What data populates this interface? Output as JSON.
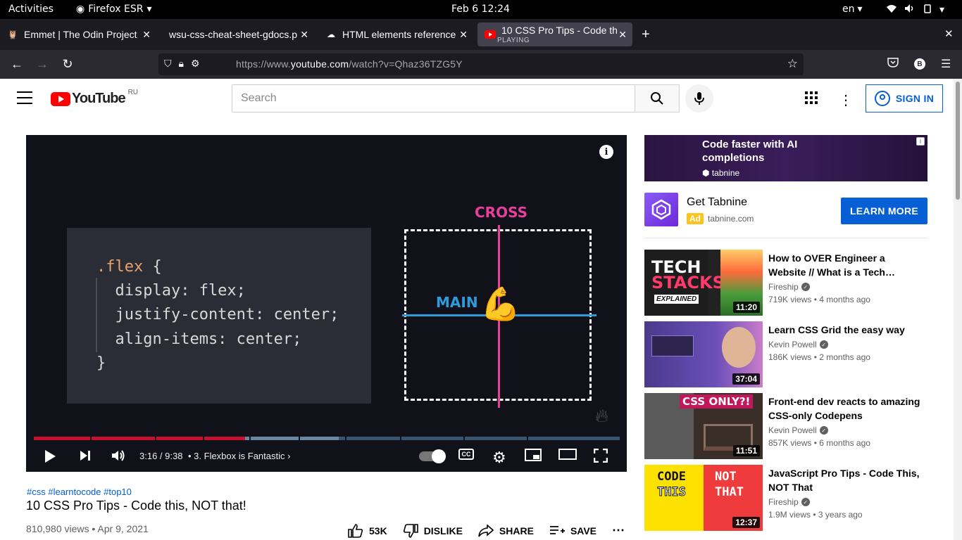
{
  "gnome": {
    "activities": "Activities",
    "app": "Firefox ESR",
    "clock": "Feb 6  12:24",
    "lang": "en"
  },
  "tabs": [
    {
      "title": "Emmet | The Odin Project",
      "favicon": "odin-icon"
    },
    {
      "title": "wsu-css-cheat-sheet-gdocs.p",
      "favicon": "none"
    },
    {
      "title": "HTML elements reference",
      "favicon": "mdn-icon"
    },
    {
      "title": "10 CSS Pro Tips - Code th",
      "sub": "PLAYING",
      "favicon": "youtube-icon"
    }
  ],
  "url": {
    "prefix": "https://www.",
    "domain": "youtube.com",
    "path": "/watch?v=Qhaz36TZG5Y"
  },
  "yt": {
    "wordmark": "YouTube",
    "country": "RU",
    "search_placeholder": "Search",
    "sign_in": "SIGN IN"
  },
  "video": {
    "code": [
      ".flex",
      " {",
      "  display: flex;",
      "  justify-content: center;",
      "  align-items: center;",
      "}"
    ],
    "cross_label": "CROSS",
    "main_label": "MAIN",
    "time": "3:16 / 9:38",
    "chapter": "3. Flexbox is Fantastic",
    "progress_played": 0.36,
    "progress_buffered": 0.52,
    "hashtags": "#css #learntocode #top10",
    "title": "10 CSS Pro Tips - Code this, NOT that!",
    "meta": "810,980 views • Apr 9, 2021",
    "likes": "53K",
    "dislike": "DISLIKE",
    "share": "SHARE",
    "save": "SAVE"
  },
  "ad": {
    "headline": "Code faster with AI completions",
    "brand_small": "tabnine",
    "title": "Get Tabnine",
    "tag": "Ad",
    "domain": "tabnine.com",
    "cta": "LEARN MORE"
  },
  "recs": [
    {
      "title": "How to OVER Engineer a Website // What is a Tech…",
      "channel": "Fireship",
      "stats": "719K views • 4 months ago",
      "duration": "11:20",
      "thumb_text": "TECH STACKS"
    },
    {
      "title": "Learn CSS Grid the easy way",
      "channel": "Kevin Powell",
      "stats": "186K views • 2 months ago",
      "duration": "37:04"
    },
    {
      "title": "Front-end dev reacts to amazing CSS-only Codepens",
      "channel": "Kevin Powell",
      "stats": "857K views • 6 months ago",
      "duration": "11:51",
      "thumb_text": "CSS ONLY?!"
    },
    {
      "title": "JavaScript Pro Tips - Code This, NOT That",
      "channel": "Fireship",
      "stats": "1.9M views • 3 years ago",
      "duration": "12:37",
      "thumb_text": "CODE THIS"
    }
  ],
  "colors": {
    "yt_red": "#ff0000",
    "link_blue": "#065fd4",
    "cross": "#e83e9c",
    "main": "#2d9cdb"
  }
}
